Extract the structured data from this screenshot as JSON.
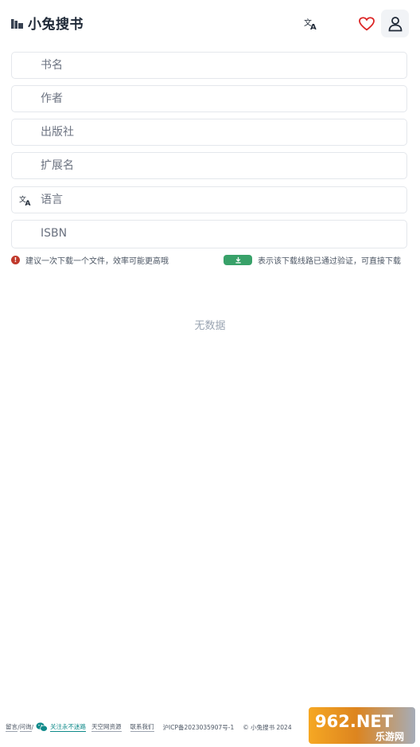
{
  "header": {
    "title": "小兔搜书",
    "logo_icon": "library-icon",
    "lang_icon": "translate-icon",
    "fav_icon": "heart-icon",
    "user_icon": "user-icon",
    "accent": "#dc2626"
  },
  "form": {
    "fields": [
      {
        "placeholder": "书名",
        "value": ""
      },
      {
        "placeholder": "作者",
        "value": ""
      },
      {
        "placeholder": "出版社",
        "value": ""
      },
      {
        "placeholder": "扩展名",
        "value": ""
      },
      {
        "placeholder": "语言",
        "value": "",
        "icon": "translate-icon"
      },
      {
        "placeholder": "ISBN",
        "value": ""
      }
    ]
  },
  "notes": {
    "left": "建议一次下载一个文件，效率可能更高哦",
    "right": "表示该下载线路已通过验证，可直接下载",
    "chip_color": "#38a169",
    "warn_color": "#c0392b"
  },
  "results": {
    "empty_text": "无数据"
  },
  "footer": {
    "msg": "留言",
    "sep1": " / ",
    "ask": "问询",
    "sep2": " / ",
    "wechat": "关注永不迷路",
    "resource": "天空网资源",
    "contact": "联系我们",
    "icp": "沪ICP备2023035907号-1",
    "copyright": "© 小兔搜书 2024"
  },
  "watermark": {
    "brand": "962.NET",
    "sub": "乐游网"
  }
}
